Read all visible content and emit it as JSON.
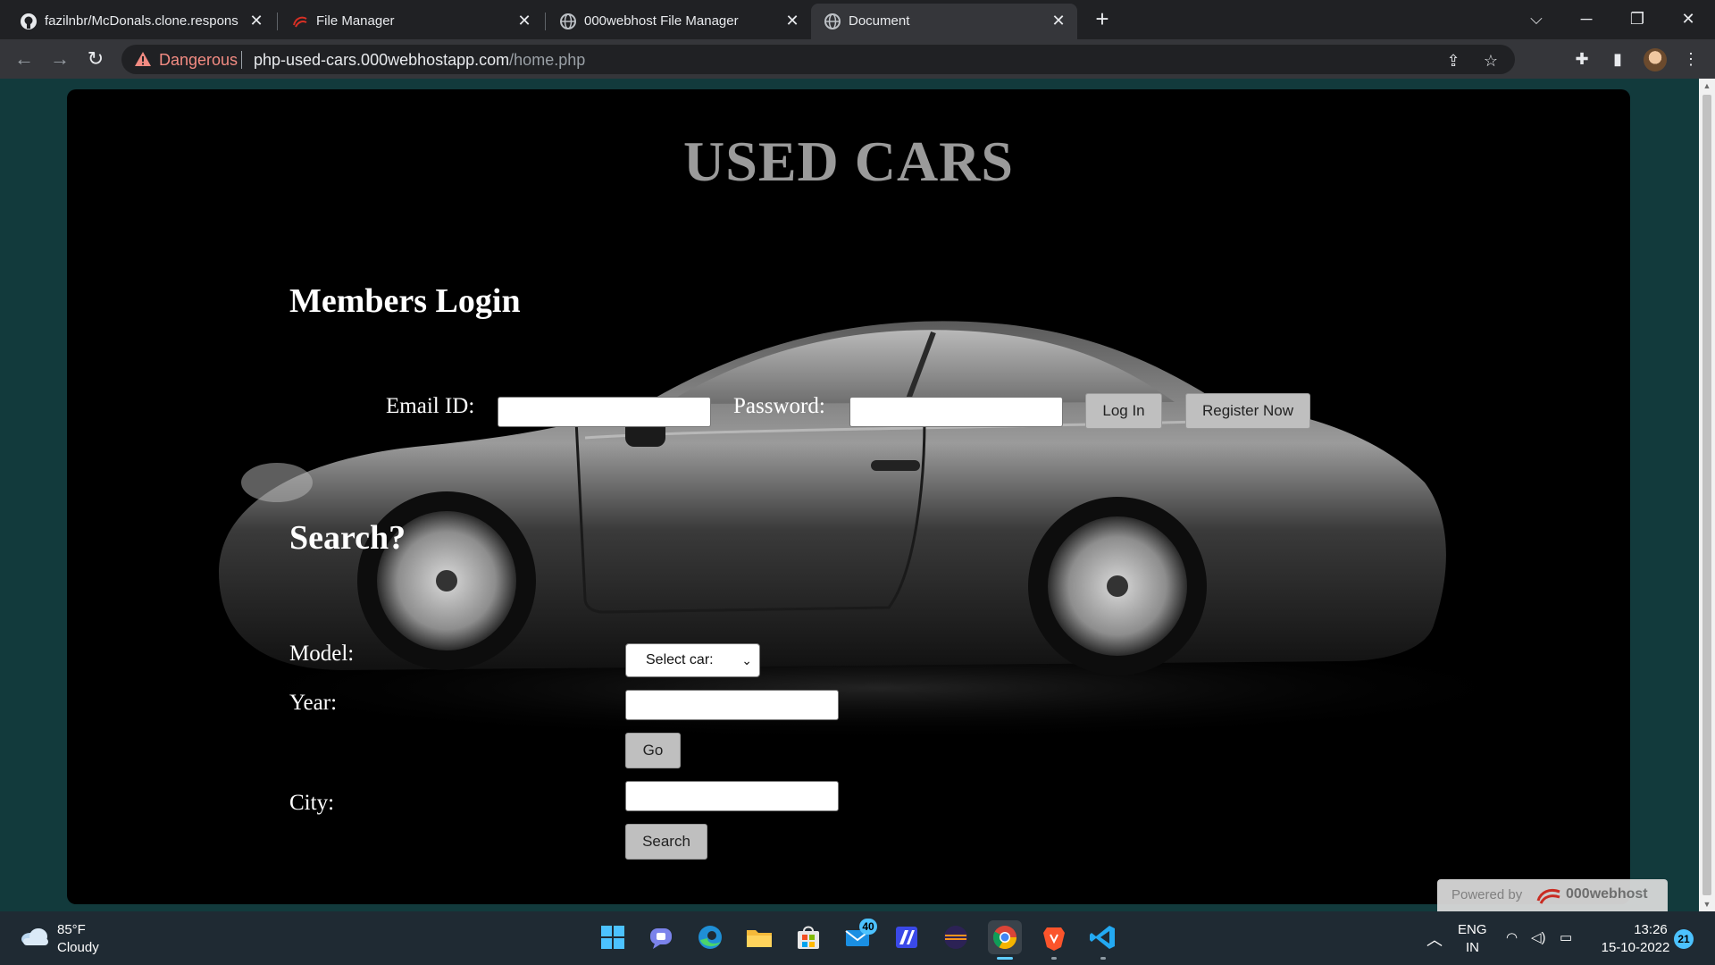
{
  "browser": {
    "tabs": [
      {
        "title": "fazilnbr/McDonals.clone.respons",
        "icon": "github-icon",
        "active": false
      },
      {
        "title": "File Manager",
        "icon": "000webhost-icon",
        "active": false
      },
      {
        "title": "000webhost File Manager",
        "icon": "globe-icon",
        "active": false
      },
      {
        "title": "Document",
        "icon": "globe-icon",
        "active": true
      }
    ],
    "security_label": "Dangerous",
    "url_host": "php-used-cars.000webhostapp.com",
    "url_path": "/home.php"
  },
  "page": {
    "site_title": "USED CARS",
    "login": {
      "heading": "Members Login",
      "email_label": "Email ID:",
      "email_value": "",
      "password_label": "Password:",
      "password_value": "",
      "login_button": "Log In",
      "register_button": "Register Now"
    },
    "search": {
      "heading": "Search?",
      "model_label": "Model:",
      "model_selected": "Select car:",
      "year_label": "Year:",
      "year_value": "",
      "go_button": "Go",
      "city_label": "City:",
      "city_value": "",
      "search_button": "Search"
    },
    "powered_by": {
      "prefix": "Powered by",
      "brand": "000webhost"
    }
  },
  "taskbar": {
    "weather_temp": "85°F",
    "weather_condition": "Cloudy",
    "apps": [
      "windows-start-icon",
      "teams-chat-icon",
      "edge-icon",
      "file-explorer-icon",
      "ms-store-icon",
      "mail-icon",
      "dev-app-icon",
      "eclipse-icon",
      "chrome-icon",
      "brave-icon",
      "vscode-icon"
    ],
    "mail_badge": "40",
    "lang_primary": "ENG",
    "lang_secondary": "IN",
    "time": "13:26",
    "date": "15-10-2022",
    "notification_count": "21"
  },
  "colors": {
    "page_bg": "#123a3c",
    "panel_bg": "#000000",
    "title_gray": "#9a9a9a",
    "danger": "#f28b82"
  }
}
